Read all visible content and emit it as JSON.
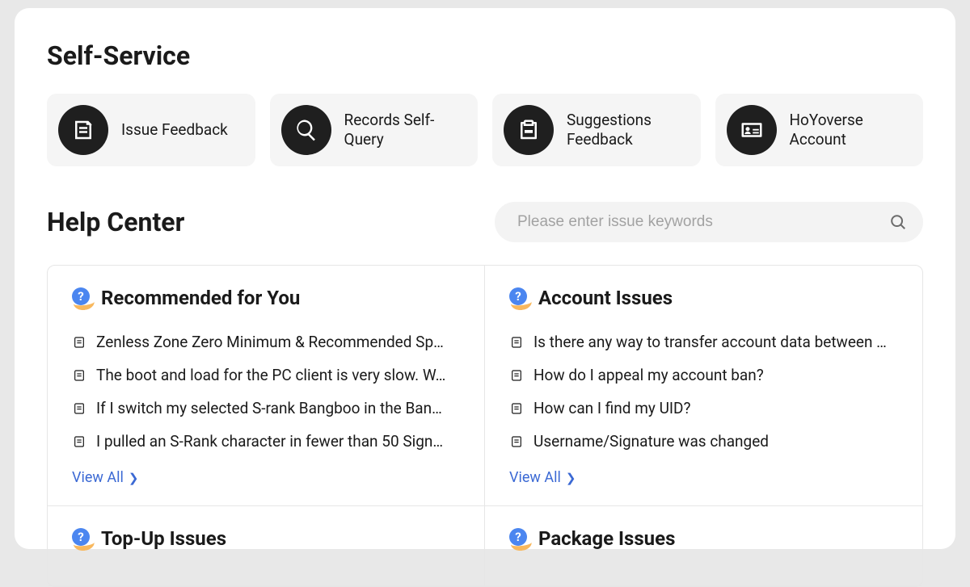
{
  "selfService": {
    "title": "Self-Service",
    "items": [
      {
        "label": "Issue Feedback"
      },
      {
        "label": "Records Self-Query"
      },
      {
        "label": "Suggestions Feedback"
      },
      {
        "label": "HoYoverse Account"
      }
    ]
  },
  "helpCenter": {
    "title": "Help Center",
    "searchPlaceholder": "Please enter issue keywords",
    "viewAllLabel": "View All",
    "categories": [
      {
        "title": "Recommended for You",
        "articles": [
          "Zenless Zone Zero Minimum & Recommended Sp…",
          "The boot and load for the PC client is very slow. W…",
          "If I switch my selected S-rank Bangboo in the Ban…",
          "I pulled an S-Rank character in fewer than 50 Sign…"
        ]
      },
      {
        "title": "Account Issues",
        "articles": [
          "Is there any way to transfer account data between …",
          "How do I appeal my account ban?",
          "How can I find my UID?",
          "Username/Signature was changed"
        ]
      },
      {
        "title": "Top-Up Issues",
        "articles": []
      },
      {
        "title": "Package Issues",
        "articles": []
      }
    ]
  }
}
